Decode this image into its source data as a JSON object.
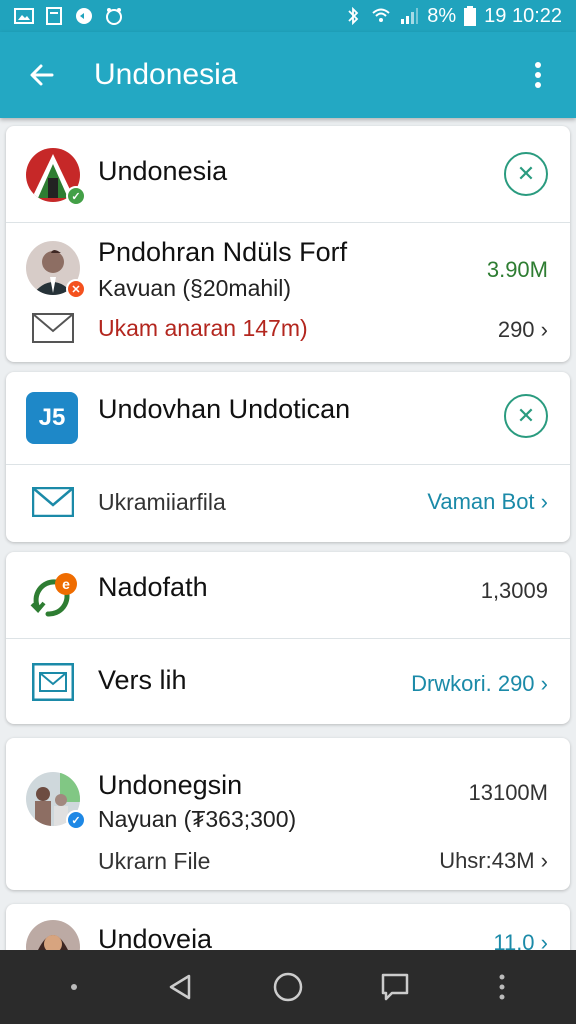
{
  "status_bar": {
    "battery": "8%",
    "time": "19 10:22"
  },
  "app_bar": {
    "title": "Undonesia"
  },
  "cards": [
    {
      "name": "Undonesia"
    },
    {
      "name": "Pndohran Ndüls Forf",
      "subtitle": "Kavuan (§20mahil)",
      "amount": "3.90M",
      "mail_text": "Ukam anaran 147m)",
      "mail_meta": "290"
    },
    {
      "name": "Undovhan Undotican",
      "mail_text": "Ukramiiarfila",
      "mail_meta": "Vaman Bot"
    },
    {
      "name": "Nadofath",
      "value": "1,3009",
      "second_name": "Vers lih",
      "second_meta": "Drwkori. 290"
    },
    {
      "name": "Undonegsin",
      "subtitle": "Nayuan (₮363;300)",
      "value": "13100M",
      "third_line": "Ukrarn File",
      "third_meta": "Uhsr:43M"
    },
    {
      "name": "Undoveia",
      "value": "11.0"
    }
  ],
  "chevron": "›"
}
